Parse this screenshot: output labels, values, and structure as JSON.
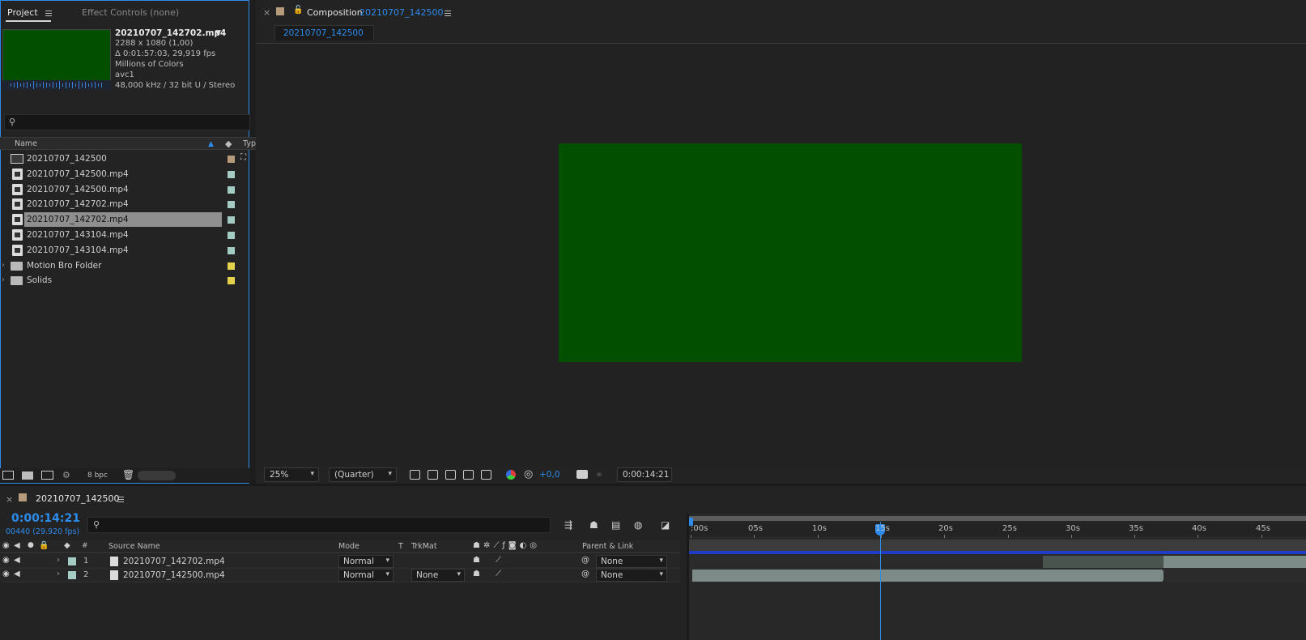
{
  "project_panel": {
    "tab_project": "Project",
    "tab_effect_controls": "Effect Controls (none)",
    "selected_item": {
      "name": "20210707_142702.mp4",
      "dimensions": "2288 x 1080 (1,00)",
      "duration_fps": "Δ 0:01:57:03, 29,919 fps",
      "colors": "Millions of Colors",
      "codec": "avc1",
      "audio": "48,000 kHz / 32 bit U / Stereo"
    },
    "search_placeholder": "",
    "columns": {
      "name": "Name",
      "type": "Typ"
    },
    "items": [
      {
        "name": "20210707_142500",
        "kind": "comp",
        "label_color": "#b59a7c",
        "selected": false
      },
      {
        "name": "20210707_142500.mp4",
        "kind": "file",
        "label_color": "#a4ccc5",
        "selected": false
      },
      {
        "name": "20210707_142500.mp4",
        "kind": "file",
        "label_color": "#a4ccc5",
        "selected": false
      },
      {
        "name": "20210707_142702.mp4",
        "kind": "file",
        "label_color": "#a4ccc5",
        "selected": false
      },
      {
        "name": "20210707_142702.mp4",
        "kind": "file",
        "label_color": "#a4ccc5",
        "selected": true
      },
      {
        "name": "20210707_143104.mp4",
        "kind": "file",
        "label_color": "#a4ccc5",
        "selected": false
      },
      {
        "name": "20210707_143104.mp4",
        "kind": "file",
        "label_color": "#a4ccc5",
        "selected": false
      },
      {
        "name": "Motion Bro Folder",
        "kind": "folder",
        "label_color": "#e3d34c",
        "selected": false
      },
      {
        "name": "Solids",
        "kind": "folder",
        "label_color": "#e3d34c",
        "selected": false
      }
    ],
    "footer_bpc": "8 bpc"
  },
  "composition_panel": {
    "title_prefix": "Composition",
    "comp_name": "20210707_142500",
    "subtab": "20210707_142500",
    "zoom": "25%",
    "resolution": "(Quarter)",
    "exposure": "+0,0",
    "timecode": "0:00:14:21",
    "frame_color": "#034f00"
  },
  "timeline": {
    "comp_tab": "20210707_142500",
    "current_time": "0:00:14:21",
    "frame_info": "00440 (29.920 fps)",
    "search_placeholder": "",
    "headers": {
      "hash": "#",
      "source_name": "Source Name",
      "mode": "Mode",
      "t": "T",
      "trkmat": "TrkMat",
      "parent_link": "Parent & Link"
    },
    "ruler_labels": [
      ":00s",
      "05s",
      "10s",
      "15s",
      "20s",
      "25s",
      "30s",
      "35s",
      "40s",
      "45s"
    ],
    "layers": [
      {
        "num": "1",
        "source": "20210707_142702.mp4",
        "mode": "Normal",
        "trkmat": "",
        "parent": "None"
      },
      {
        "num": "2",
        "source": "20210707_142500.mp4",
        "mode": "Normal",
        "trkmat": "None",
        "parent": "None"
      }
    ]
  }
}
